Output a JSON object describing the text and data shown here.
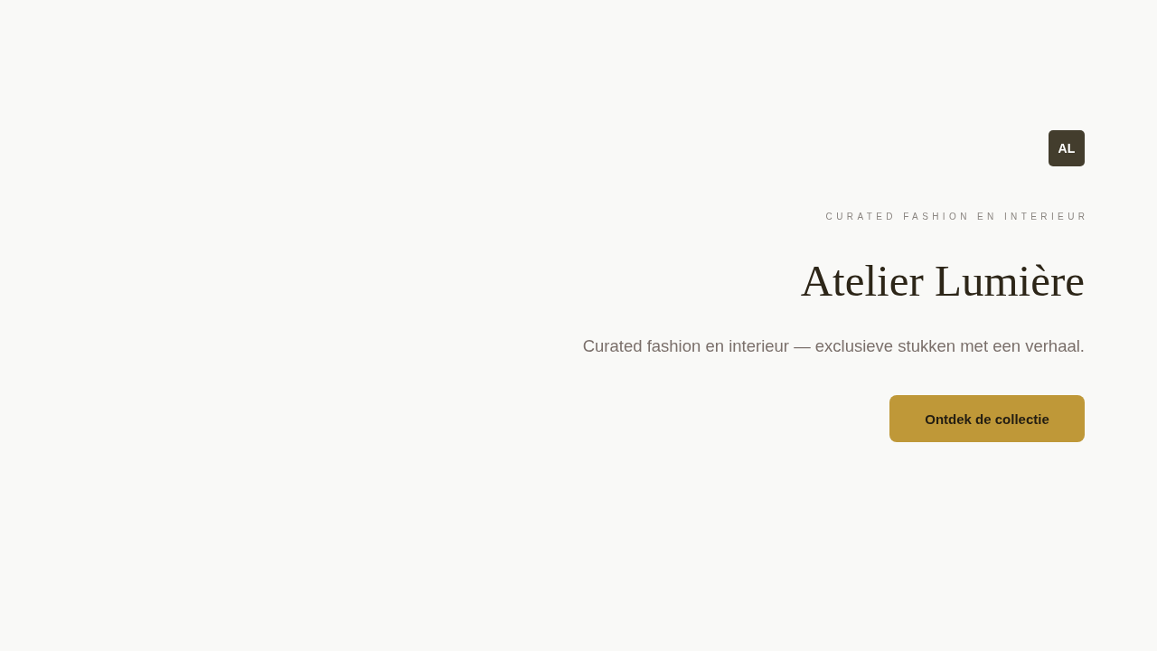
{
  "logo": {
    "text": "AL"
  },
  "hero": {
    "eyebrow": "CURATED FASHION EN INTERIEUR",
    "title": "Atelier Lumière",
    "subtitle": "Curated fashion en interieur — exclusieve stukken met een verhaal.",
    "cta": {
      "label": "Ontdek de collectie"
    }
  }
}
